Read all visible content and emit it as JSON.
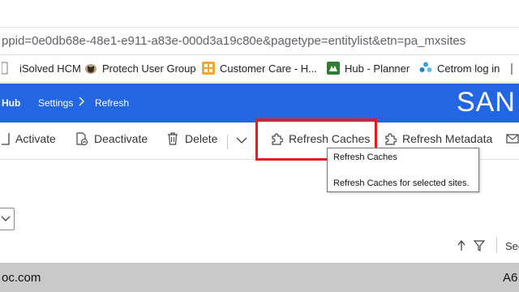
{
  "browser": {
    "url": "ppid=0e0db68e-48e1-e911-a83e-000d3a19c80e&pagetype=entitylist&etn=pa_mxsites"
  },
  "bookmarks": [
    {
      "label": "iSolved HCM",
      "icon": "document-icon"
    },
    {
      "label": "Protech User Group",
      "icon": "pug-dog-icon"
    },
    {
      "label": "Customer Care - H...",
      "icon": "customer-care-icon"
    },
    {
      "label": "Hub - Planner",
      "icon": "planner-icon"
    },
    {
      "label": "Cetrom log in",
      "icon": "cetrom-icon"
    }
  ],
  "navbar": {
    "hub": "Hub",
    "settings": "Settings",
    "current": "Refresh",
    "brand": "SAN",
    "color": "#2266e3"
  },
  "commands": {
    "activate": "Activate",
    "deactivate": "Deactivate",
    "delete": "Delete",
    "refresh_caches": "Refresh Caches",
    "refresh_metadata": "Refresh Metadata"
  },
  "tooltip": {
    "title": "Refresh Caches",
    "description": "Refresh Caches for selected sites."
  },
  "grid": {
    "column_partial": "Sec",
    "row_left": "oc.com",
    "row_right": "A6"
  },
  "colors": {
    "highlight": "#e81c1c",
    "accent": "#2266e3"
  }
}
